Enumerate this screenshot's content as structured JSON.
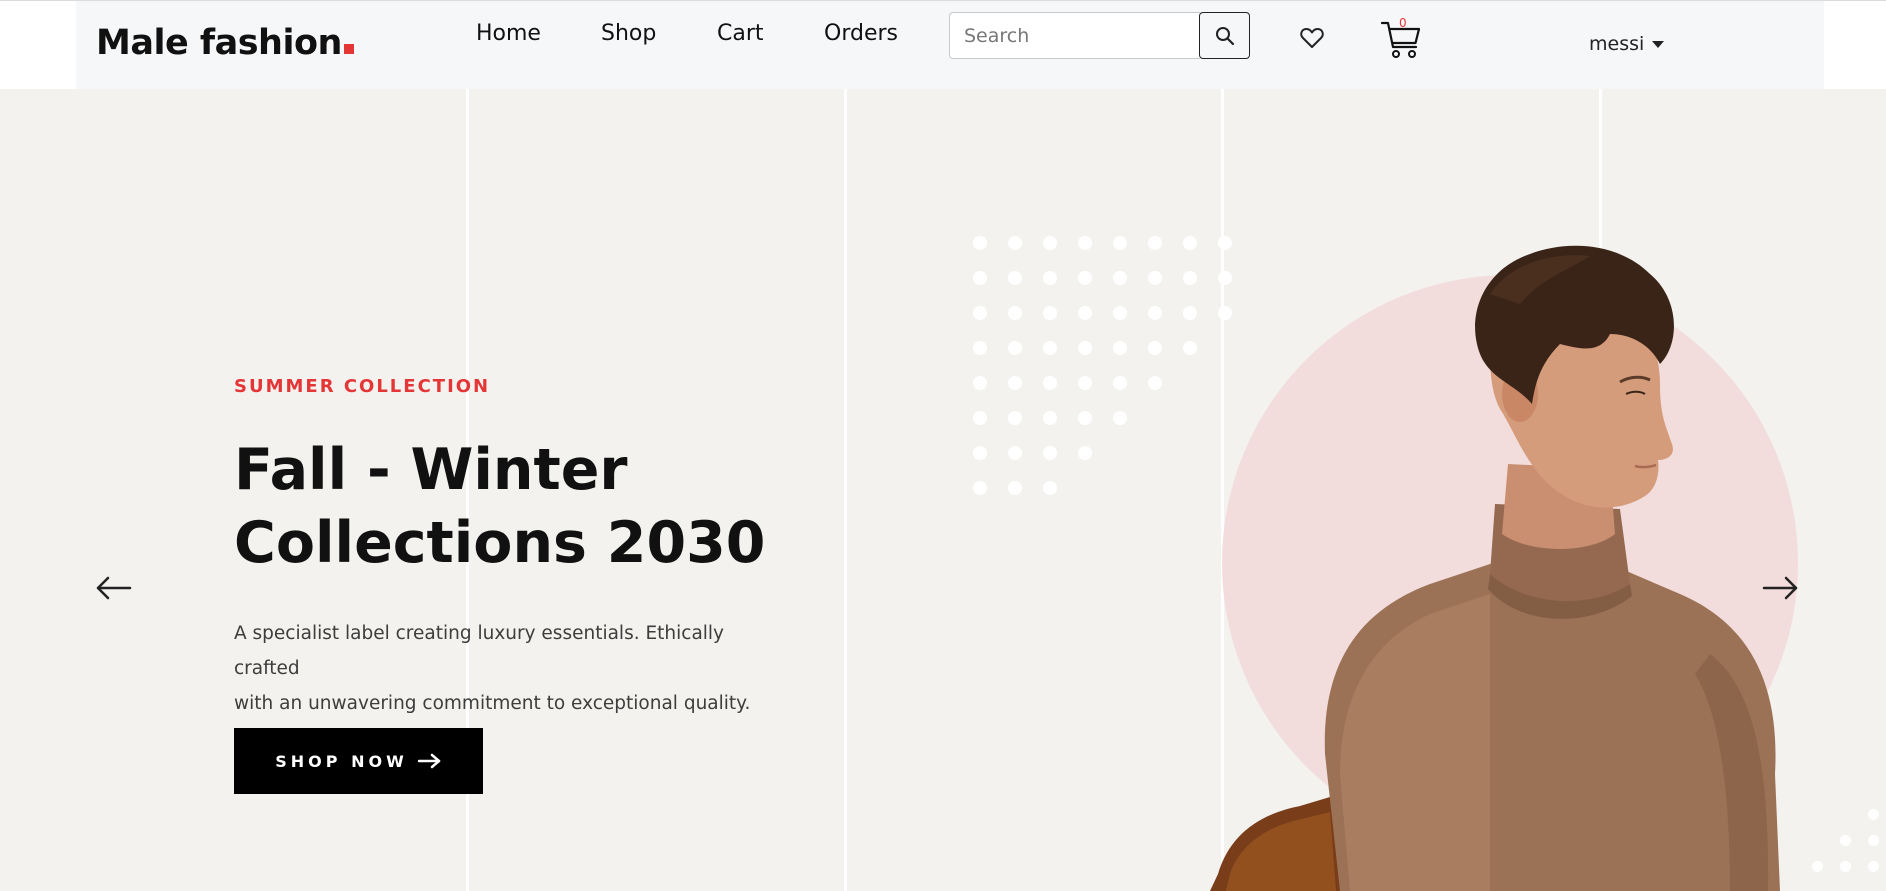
{
  "navbar": {
    "logo_text": "Male fashion",
    "links": [
      {
        "label": "Home"
      },
      {
        "label": "Shop"
      },
      {
        "label": "Cart"
      },
      {
        "label": "Orders"
      }
    ],
    "search": {
      "placeholder": "Search",
      "value": ""
    },
    "cart_count": "0",
    "user_name": "messi",
    "icons": {
      "search": "search-icon",
      "wishlist": "heart-icon",
      "cart": "cart-icon",
      "dropdown": "caret-down-icon"
    }
  },
  "hero": {
    "eyebrow": "SUMMER COLLECTION",
    "title_line1": "Fall - Winter",
    "title_line2": "Collections 2030",
    "description_line1": "A specialist label creating luxury essentials. Ethically crafted",
    "description_line2": "with an unwavering commitment to exceptional quality.",
    "cta_label": "SHOP NOW",
    "prev_icon": "arrow-left-icon",
    "next_icon": "arrow-right-icon"
  },
  "colors": {
    "accent": "#e53637",
    "hero_bg": "#f3f2ee",
    "circle": "#f2dddc",
    "navbar_bg": "#f6f7f9",
    "button_bg": "#000000"
  }
}
